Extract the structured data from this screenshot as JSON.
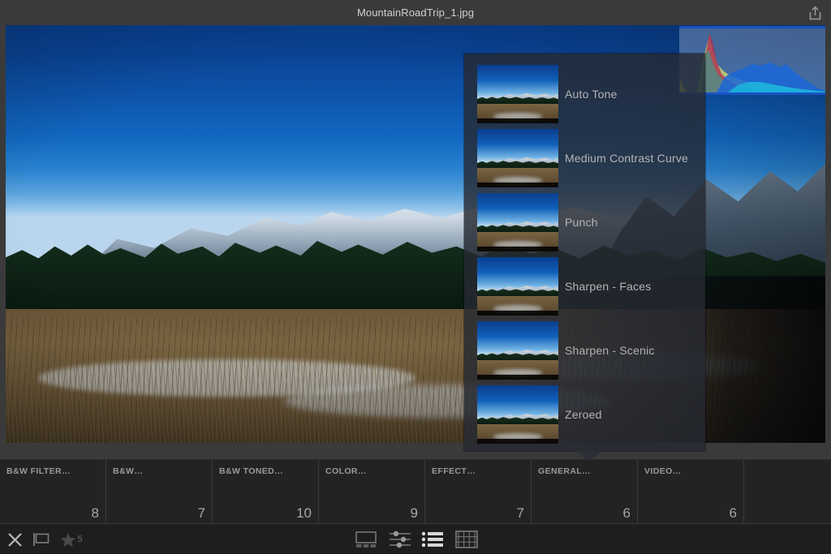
{
  "titlebar": {
    "title": "MountainRoadTrip_1.jpg",
    "share_icon": "upload-arrow-icon"
  },
  "photo": {
    "name": "MountainRoadTrip_1.jpg",
    "alt": "Snow-capped mountain range above a dark evergreen treeline with a dry winter meadow in the foreground"
  },
  "histogram": {
    "name": "histogram-overlay",
    "channels": [
      "red",
      "green",
      "blue",
      "luminance"
    ]
  },
  "preset_popup": {
    "name": "preset-list-popup",
    "items": [
      {
        "label": "Auto Tone",
        "thumb": "preset-thumbnail"
      },
      {
        "label": "Medium Contrast Curve",
        "thumb": "preset-thumbnail"
      },
      {
        "label": "Punch",
        "thumb": "preset-thumbnail"
      },
      {
        "label": "Sharpen - Faces",
        "thumb": "preset-thumbnail"
      },
      {
        "label": "Sharpen - Scenic",
        "thumb": "preset-thumbnail"
      },
      {
        "label": "Zeroed",
        "thumb": "preset-thumbnail"
      }
    ]
  },
  "categories": [
    {
      "name": "B&W FILTER…",
      "count": "8"
    },
    {
      "name": "B&W…",
      "count": "7"
    },
    {
      "name": "B&W TONED…",
      "count": "10"
    },
    {
      "name": "COLOR…",
      "count": "9"
    },
    {
      "name": "EFFECT…",
      "count": "7"
    },
    {
      "name": "GENERAL…",
      "count": "6"
    },
    {
      "name": "VIDEO…",
      "count": "6"
    },
    {
      "name": "",
      "count": ""
    }
  ],
  "toolbar": {
    "reject_icon": "reject-x-icon",
    "flag_icon": "flag-icon",
    "star_icon": "star-icon",
    "star_count": "5",
    "loupe_icon": "loupe-view-icon",
    "adjust_icon": "adjust-sliders-icon",
    "list_icon": "list-view-icon",
    "grid_icon": "grid-view-icon"
  },
  "colors": {
    "window_bg": "#3a3a3a",
    "panel_bg": "#232323",
    "toolbar_bg": "#1e1e1e",
    "popup_bg": "rgba(38,42,50,0.82)",
    "text": "#d2d2d2",
    "muted_text": "#9a9a9a",
    "accent_blue": "#1450c8"
  }
}
